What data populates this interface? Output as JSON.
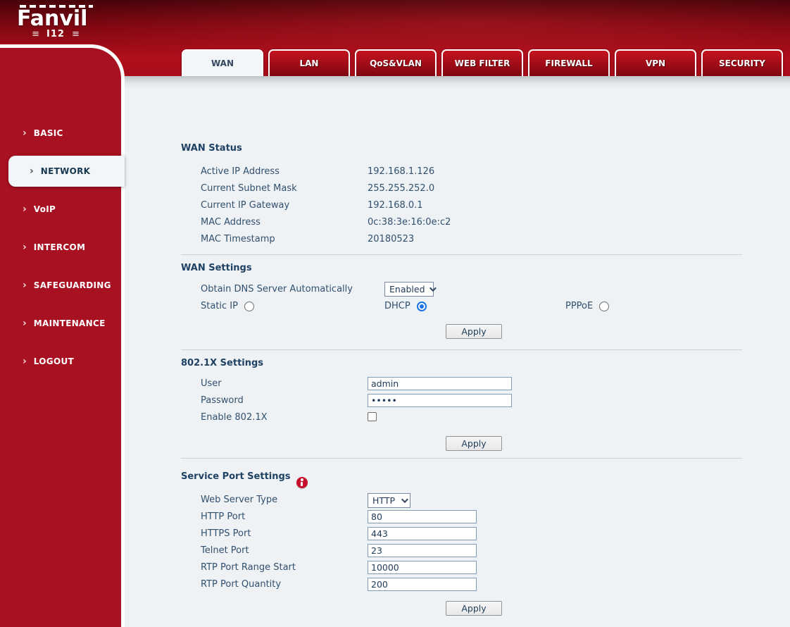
{
  "header": {
    "brand": "Fanvil",
    "model": "I12",
    "tabs": [
      {
        "label": "WAN",
        "active": true
      },
      {
        "label": "LAN",
        "active": false
      },
      {
        "label": "QoS&VLAN",
        "active": false
      },
      {
        "label": "WEB FILTER",
        "active": false
      },
      {
        "label": "FIREWALL",
        "active": false
      },
      {
        "label": "VPN",
        "active": false
      },
      {
        "label": "SECURITY",
        "active": false
      }
    ]
  },
  "sidebar": {
    "items": [
      {
        "label": "BASIC",
        "active": false
      },
      {
        "label": "NETWORK",
        "active": true
      },
      {
        "label": "VoIP",
        "active": false
      },
      {
        "label": "INTERCOM",
        "active": false
      },
      {
        "label": "SAFEGUARDING",
        "active": false
      },
      {
        "label": "MAINTENANCE",
        "active": false
      },
      {
        "label": "LOGOUT",
        "active": false
      }
    ]
  },
  "wan_status": {
    "title": "WAN Status",
    "rows": [
      {
        "label": "Active IP Address",
        "value": "192.168.1.126"
      },
      {
        "label": "Current Subnet Mask",
        "value": "255.255.252.0"
      },
      {
        "label": "Current IP Gateway",
        "value": "192.168.0.1"
      },
      {
        "label": "MAC Address",
        "value": "0c:38:3e:16:0e:c2"
      },
      {
        "label": "MAC Timestamp",
        "value": "20180523"
      }
    ]
  },
  "wan_settings": {
    "title": "WAN Settings",
    "dns_label": "Obtain DNS Server Automatically",
    "dns_value": "Enabled",
    "radios": [
      {
        "label": "Static IP",
        "selected": false
      },
      {
        "label": "DHCP",
        "selected": true
      },
      {
        "label": "PPPoE",
        "selected": false
      }
    ],
    "apply_label": "Apply"
  },
  "dot1x": {
    "title": "802.1X Settings",
    "user_label": "User",
    "user_value": "admin",
    "password_label": "Password",
    "password_value": "•••••",
    "enable_label": "Enable 802.1X",
    "enable_checked": false,
    "apply_label": "Apply"
  },
  "service_port": {
    "title": "Service Port Settings",
    "web_server_label": "Web Server Type",
    "web_server_value": "HTTP",
    "fields": [
      {
        "label": "HTTP Port",
        "value": "80"
      },
      {
        "label": "HTTPS Port",
        "value": "443"
      },
      {
        "label": "Telnet Port",
        "value": "23"
      },
      {
        "label": "RTP Port Range Start",
        "value": "10000"
      },
      {
        "label": "RTP Port Quantity",
        "value": "200"
      }
    ],
    "apply_label": "Apply"
  },
  "colors": {
    "header_red": "#a80d19",
    "sidebar_red": "#a81122",
    "text_navy": "#31506f",
    "radio_selected_blue": "#1a73e8",
    "help_icon_red": "#c60f2d"
  }
}
